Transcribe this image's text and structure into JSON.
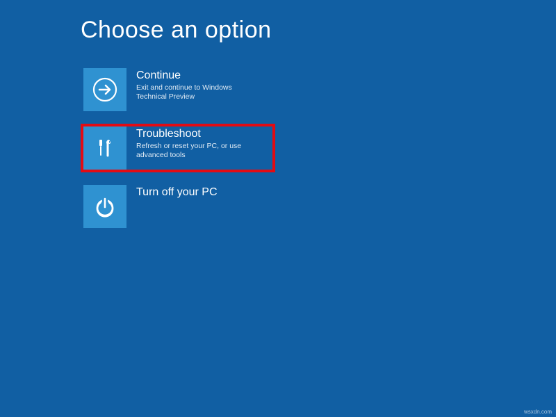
{
  "title": "Choose an option",
  "options": {
    "continue": {
      "title": "Continue",
      "desc": "Exit and continue to Windows Technical Preview"
    },
    "troubleshoot": {
      "title": "Troubleshoot",
      "desc": "Refresh or reset your PC, or use advanced tools"
    },
    "turnoff": {
      "title": "Turn off your PC",
      "desc": ""
    }
  },
  "highlight_color": "#e30b13",
  "tile_color": "#2f92d1",
  "background_color": "#115fa3",
  "watermark": "wsxdn.com"
}
